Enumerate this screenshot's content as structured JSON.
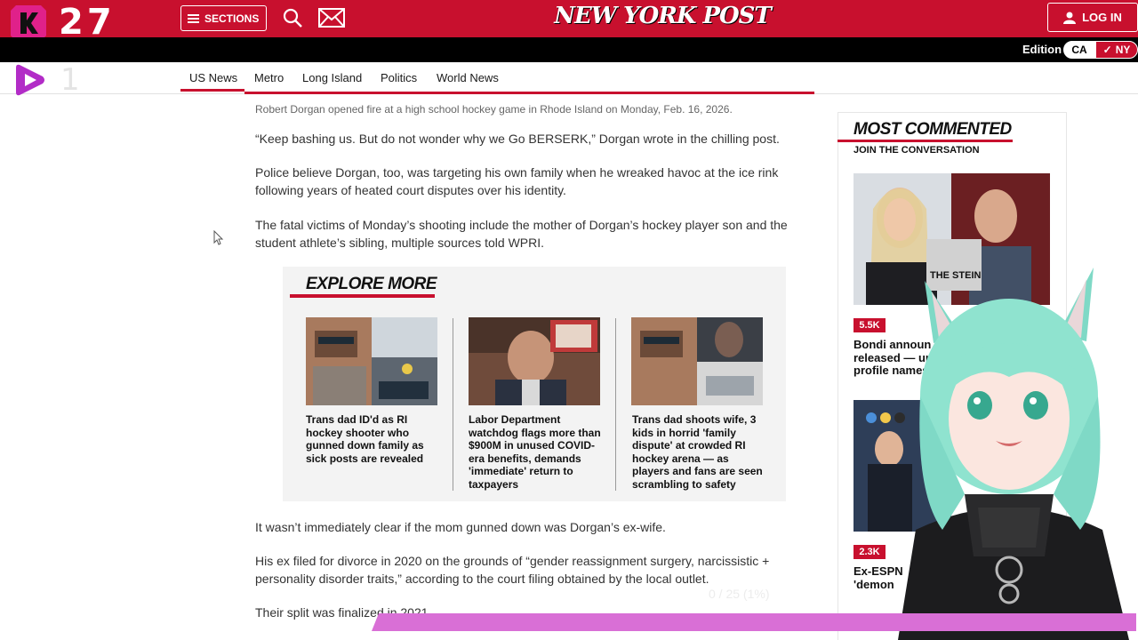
{
  "overlay": {
    "top_counter": "27",
    "mid_counter": "1",
    "bottom_counter": "0 / 25 (1%)",
    "pink_accent": "#d96fd6"
  },
  "header": {
    "sections_label": "SECTIONS",
    "logo_text": "NEW YORK POST",
    "login_label": "LOG IN",
    "edition_label": "Edition",
    "edition_ca": "CA",
    "edition_ny": "NY",
    "brand_color": "#c8102e"
  },
  "nav": {
    "items": [
      "US News",
      "Metro",
      "Long Island",
      "Politics",
      "World News"
    ],
    "active": "US News"
  },
  "article": {
    "caption": "Robert Dorgan opened fire at a high school hockey game in Rhode Island on Monday, Feb. 16, 2026.",
    "paragraphs": [
      "“Keep bashing us. But do not wonder why we Go BERSERK,” Dorgan wrote in the chilling post.",
      "Police believe Dorgan, too, was targeting his own family when he wreaked havoc at the ice rink following years of heated court disputes over his identity.",
      "The fatal victims of Monday’s shooting include the mother of Dorgan’s hockey player son and the student athlete’s sibling, multiple sources told WPRI.",
      "It wasn’t immediately clear if the mom gunned down was Dorgan’s ex-wife.",
      "His ex filed for divorce in 2020 on the grounds of “gender reassignment surgery, narcissistic + personality disorder traits,” according to the court filing obtained by the local outlet.",
      "Their split was finalized in 2021."
    ]
  },
  "explore": {
    "title": "EXPLORE MORE",
    "cards": [
      {
        "title": "Trans dad ID'd as RI hockey shooter who gunned down family as sick posts are revealed"
      },
      {
        "title": "Labor Department watchdog flags more than $900M in unused COVID-era benefits, demands 'immediate' return to taxpayers"
      },
      {
        "title": "Trans dad shoots wife, 3 kids in horrid 'family dispute' at crowded RI hockey arena — as players and fans are seen scrambling to safety"
      }
    ]
  },
  "sidebar": {
    "title": "MOST COMMENTED",
    "subtitle": "JOIN THE CONVERSATION",
    "items": [
      {
        "count": "5.5K",
        "text": "Bondi announ released — un profile names"
      },
      {
        "count": "2.3K",
        "text": "Ex-ESPN 'demon"
      }
    ],
    "image_text": "THE STEIN"
  }
}
